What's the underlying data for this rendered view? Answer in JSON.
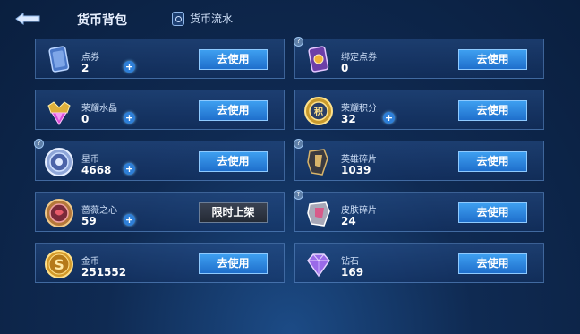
{
  "header": {
    "title": "货币背包",
    "flow_label": "货币流水"
  },
  "items": [
    {
      "key": "voucher",
      "name": "点券",
      "amount": "2",
      "action": "去使用",
      "plus": true
    },
    {
      "key": "bound-voucher",
      "name": "绑定点券",
      "amount": "0",
      "action": "去使用",
      "plus": false
    },
    {
      "key": "glory-crystal",
      "name": "荣耀水晶",
      "amount": "0",
      "action": "去使用",
      "plus": true
    },
    {
      "key": "glory-points",
      "name": "荣耀积分",
      "amount": "32",
      "action": "去使用",
      "plus": true
    },
    {
      "key": "star-coin",
      "name": "星币",
      "amount": "4668",
      "action": "去使用",
      "plus": true
    },
    {
      "key": "hero-fragment",
      "name": "英雄碎片",
      "amount": "1039",
      "action": "去使用",
      "plus": false
    },
    {
      "key": "rose-heart",
      "name": "蔷薇之心",
      "amount": "59",
      "action": "限时上架",
      "plus": true
    },
    {
      "key": "skin-fragment",
      "name": "皮肤碎片",
      "amount": "24",
      "action": "去使用",
      "plus": false
    },
    {
      "key": "gold-coin",
      "name": "金币",
      "amount": "251552",
      "action": "去使用",
      "plus": false
    },
    {
      "key": "diamond",
      "name": "钻石",
      "amount": "169",
      "action": "去使用",
      "plus": false
    }
  ]
}
